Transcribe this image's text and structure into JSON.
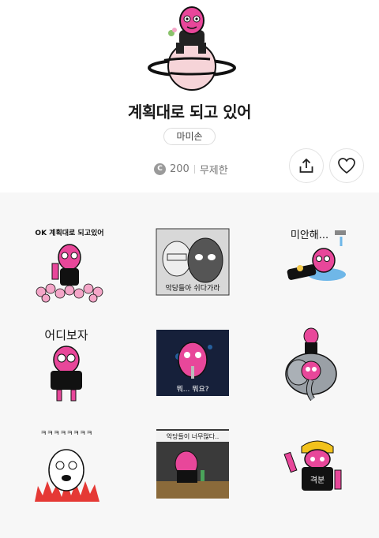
{
  "product": {
    "title": "계획대로 되고 있어",
    "author": "마미손",
    "coin_symbol": "C",
    "price": "200",
    "validity": "무제한"
  },
  "colors": {
    "accent_pink": "#e8479a",
    "coin_gray": "#9a9a9a",
    "grid_background": "#f7f7f7"
  },
  "icons": {
    "share": "share-icon",
    "like": "heart-icon"
  },
  "stickers": [
    {
      "caption": "OK 계획대로 되고있어"
    },
    {
      "caption": "악당들아 쉬다가라"
    },
    {
      "caption": "미안해..."
    },
    {
      "caption": "어디보자"
    },
    {
      "caption": "뭐... 뭐요?"
    },
    {
      "caption": ""
    },
    {
      "caption": "ㅋㅋㅋㅋㅋㅋㅋㅋ"
    },
    {
      "caption": "악당들이 너무많다.."
    },
    {
      "caption": "격분"
    }
  ]
}
